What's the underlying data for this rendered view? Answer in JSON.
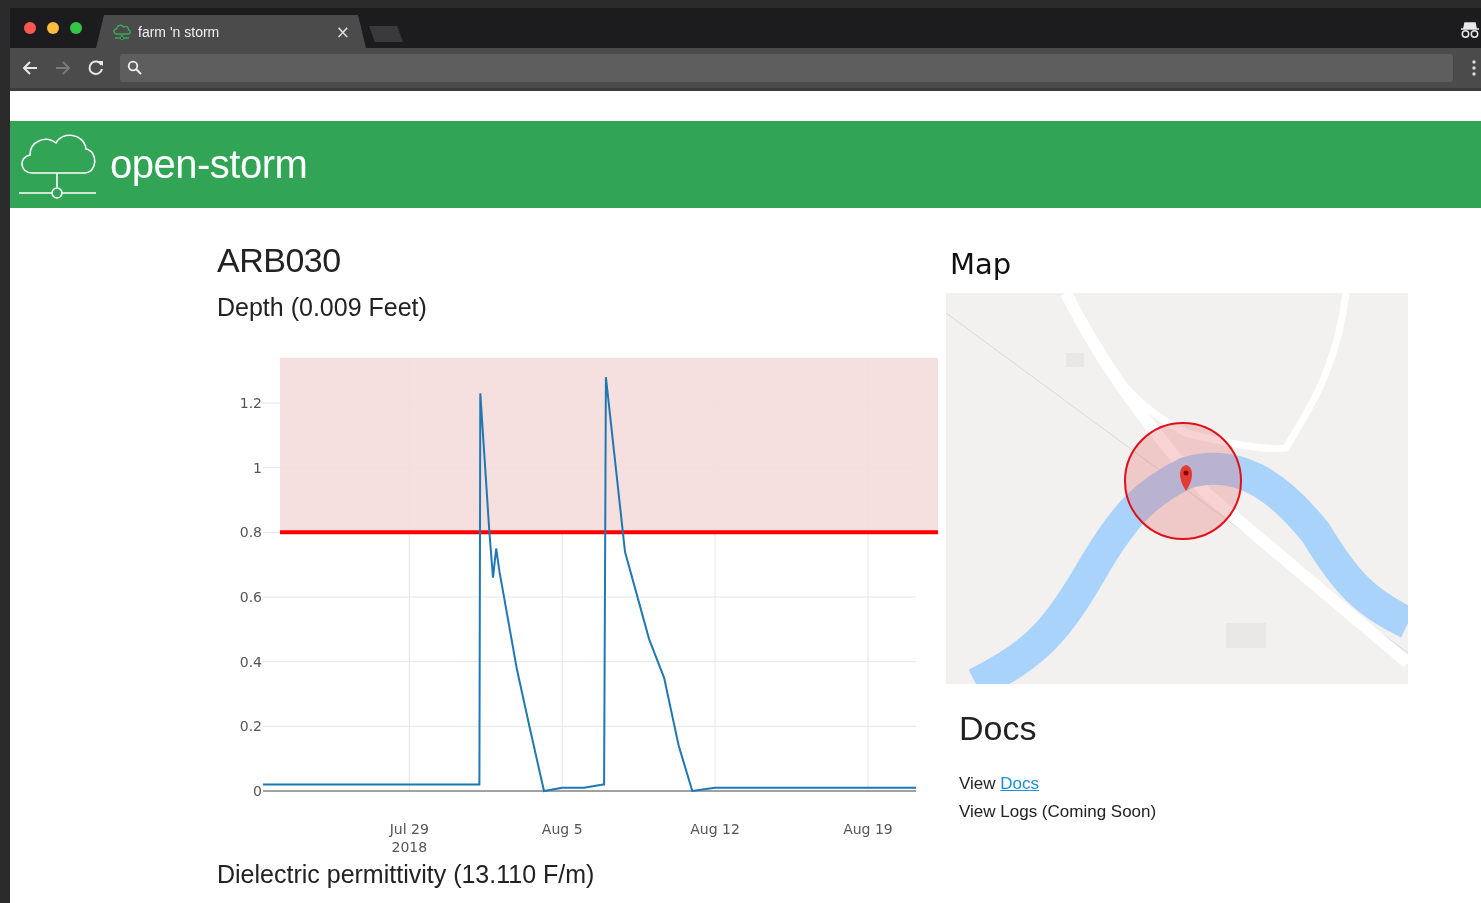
{
  "browser": {
    "tabs": [
      {
        "title": "farm 'n storm",
        "close": "×",
        "selected": true
      }
    ],
    "nav_buttons": [
      {
        "kind": "back",
        "disabled": false
      },
      {
        "kind": "forward",
        "disabled": true
      },
      {
        "kind": "reload",
        "disabled": false
      }
    ]
  },
  "site_header": {
    "brand": "open-storm"
  },
  "station": {
    "title": "ARB030",
    "depth_heading": "Depth (0.009 Feet)",
    "chart_data": {
      "type": "line",
      "xlim": [
        "2018-07-22T07:12",
        "2018-08-21T04:48"
      ],
      "grid": true,
      "ylim": [
        0,
        1.34
      ],
      "xticks": [
        {
          "value": "2018-07-29",
          "label": "Jul 29\n2018"
        },
        {
          "value": "2018-08-05",
          "label": "Aug 5"
        },
        {
          "value": "2018-08-12",
          "label": "Aug 12"
        },
        {
          "value": "2018-08-19",
          "label": "Aug 19"
        }
      ],
      "yticks": [
        0,
        0.2,
        0.4,
        0.6,
        0.8,
        1,
        {
          "value": 1.2,
          "label": "1.2"
        }
      ],
      "series": [
        {
          "color": "#1f77b4",
          "x": [
            "2018-07-22T07:12",
            "2018-07-24",
            "2018-07-26",
            "2018-07-28",
            "2018-07-30",
            "2018-07-31T22:00",
            "2018-08-01T05:00",
            "2018-08-01T06:00",
            "2018-08-01T16:00",
            "2018-08-01T20:00",
            "2018-08-01T23:30",
            "2018-08-02T03:00",
            "2018-08-02T22:00",
            "2018-08-03T12:00",
            "2018-08-04T04:00",
            "2018-08-05",
            "2018-08-06",
            "2018-08-06T21:00",
            "2018-08-06T22:00",
            "2018-08-07",
            "2018-08-07T21:00",
            "2018-08-08T23:30",
            "2018-08-09T16:00",
            "2018-08-10T08:00",
            "2018-08-10T23:00",
            "2018-08-12",
            "2018-08-15",
            "2018-08-18",
            "2018-08-21T04:48"
          ],
          "values": [
            0.02,
            0.02,
            0.02,
            0.02,
            0.02,
            0.02,
            0.02,
            1.23,
            0.8,
            0.66,
            0.75,
            0.68,
            0.38,
            0.2,
            0.0,
            0.01,
            0.01,
            0.02,
            0.02,
            1.28,
            0.74,
            0.47,
            0.35,
            0.14,
            0.0,
            0.01,
            0.01,
            0.01,
            0.01
          ]
        }
      ],
      "bands": [
        {
          "axis": "y",
          "from": 0.8,
          "to": 1.34,
          "color": "#f5dcdc"
        }
      ],
      "ref_lines": [
        {
          "axis": "y",
          "value": 0.8,
          "color": "#ff0000"
        }
      ]
    },
    "next_heading": "Dielectric permittivity (13.110 F/m)"
  },
  "map": {
    "heading": "Map",
    "kind": "picture"
  },
  "docs": {
    "heading": "Docs",
    "lines": [
      {
        "text": "View ",
        "link": "Docs"
      },
      {
        "text": "View Logs (Coming Soon)"
      }
    ]
  }
}
